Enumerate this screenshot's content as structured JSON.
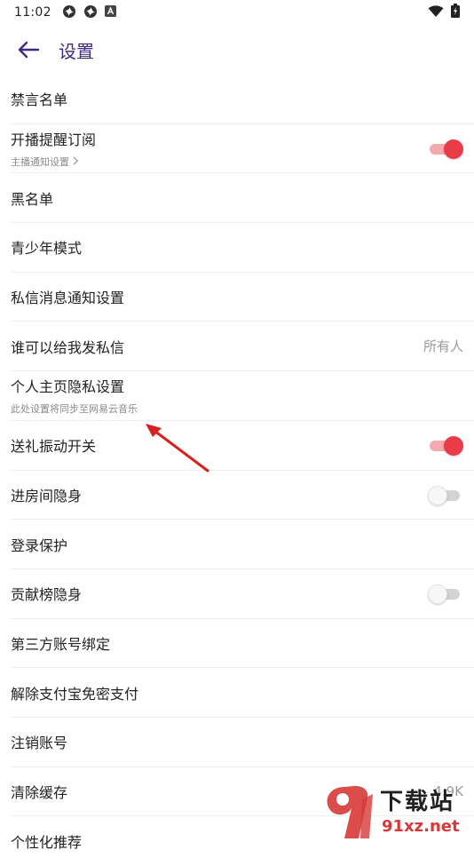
{
  "status_bar": {
    "time": "11:02",
    "notification_icons": [
      "pinwheel-icon",
      "pinwheel-icon",
      "a-box-icon"
    ],
    "wifi": "wifi-icon",
    "battery": "battery-charging-icon"
  },
  "header": {
    "title": "设置",
    "back_icon": "arrow-left-icon"
  },
  "settings": {
    "banned_words": {
      "label": "禁言名单"
    },
    "live_reminder": {
      "label": "开播提醒订阅",
      "sub": "主播通知设置",
      "toggle": "on"
    },
    "blacklist": {
      "label": "黑名单"
    },
    "teen_mode": {
      "label": "青少年模式"
    },
    "dm_notify": {
      "label": "私信消息通知设置"
    },
    "who_can_dm": {
      "label": "谁可以给我发私信",
      "value": "所有人"
    },
    "homepage_privacy": {
      "label": "个人主页隐私设置",
      "sub": "此处设置将同步至网易云音乐"
    },
    "gift_vibration": {
      "label": "送礼振动开关",
      "toggle": "on"
    },
    "room_hidden": {
      "label": "进房间隐身",
      "toggle": "off"
    },
    "login_protect": {
      "label": "登录保护"
    },
    "rank_hidden": {
      "label": "贡献榜隐身",
      "toggle": "off"
    },
    "third_party": {
      "label": "第三方账号绑定"
    },
    "alipay_unbind": {
      "label": "解除支付宝免密支付"
    },
    "cancel_account": {
      "label": "注销账号"
    },
    "clear_cache": {
      "label": "清除缓存",
      "value": "4.9K"
    },
    "personalized": {
      "label": "个性化推荐"
    }
  },
  "watermark": {
    "top_text": "下载站",
    "bottom_text": "91xz.net"
  },
  "colors": {
    "accent_title": "#3f2a82",
    "toggle_on": "#ea3b48",
    "toggle_on_track": "#f3a9ad",
    "annotation_arrow": "#d82020"
  }
}
